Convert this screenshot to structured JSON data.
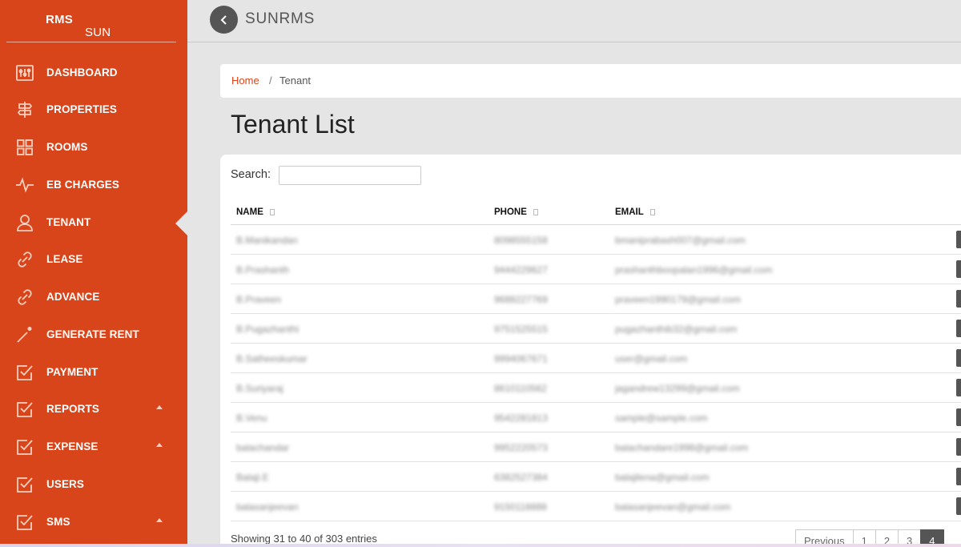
{
  "sidebar": {
    "brand_light": "SUN",
    "brand_bold": "RMS",
    "items": [
      {
        "label": "DASHBOARD",
        "icon": "dashboard-icon"
      },
      {
        "label": "PROPERTIES",
        "icon": "signpost-icon"
      },
      {
        "label": "ROOMS",
        "icon": "grid-icon"
      },
      {
        "label": "EB CHARGES",
        "icon": "pulse-icon"
      },
      {
        "label": "TENANT",
        "icon": "user-icon"
      },
      {
        "label": "LEASE",
        "icon": "link-icon"
      },
      {
        "label": "ADVANCE",
        "icon": "link-icon"
      },
      {
        "label": "GENERATE RENT",
        "icon": "magic-wand-icon"
      },
      {
        "label": "PAYMENT",
        "icon": "checkbox-icon"
      },
      {
        "label": "REPORTS",
        "icon": "checkbox-icon"
      },
      {
        "label": "EXPENSE",
        "icon": "checkbox-icon"
      },
      {
        "label": "USERS",
        "icon": "checkbox-icon"
      },
      {
        "label": "SMS",
        "icon": "checkbox-icon"
      }
    ],
    "active_item": "TENANT"
  },
  "topbar": {
    "title": "SUNRMS"
  },
  "breadcrumb": {
    "home": "Home",
    "separator": "/",
    "current": "Tenant"
  },
  "page": {
    "title": "Tenant List"
  },
  "search": {
    "label": "Search:",
    "value": ""
  },
  "table": {
    "columns": [
      "NAME",
      "PHONE",
      "EMAIL"
    ],
    "rows": [
      {
        "name": "B.Manikandan",
        "phone": "8098555158",
        "email": "bmaniprabash007@gmail.com"
      },
      {
        "name": "B.Prashanth",
        "phone": "9444229627",
        "email": "prashanthboopalan1996@gmail.com"
      },
      {
        "name": "B.Praveen",
        "phone": "9688227769",
        "email": "praveen1990179@gmail.com"
      },
      {
        "name": "B.Pugazhanthi",
        "phone": "9751525515",
        "email": "pugazhanthib32@gmail.com"
      },
      {
        "name": "B.Satheeskumar",
        "phone": "9994067671",
        "email": "user@gmail.com"
      },
      {
        "name": "B.Suriyaraj",
        "phone": "8610110562",
        "email": "jagandrew13299@gmail.com"
      },
      {
        "name": "B.Venu",
        "phone": "9542281813",
        "email": "sample@sample.com"
      },
      {
        "name": "balachandar",
        "phone": "9952220573",
        "email": "balachandare1998@gmail.com"
      },
      {
        "name": "Balaji.E",
        "phone": "6382527384",
        "email": "balajilena@gmail.com"
      },
      {
        "name": "balasanjeevan",
        "phone": "9150118888",
        "email": "balasanjeevan@gmail.com"
      }
    ]
  },
  "footer": {
    "showing": "Showing 31 to 40 of 303 entries",
    "pager": [
      "Previous",
      "1",
      "2",
      "3",
      "4"
    ],
    "active_page": "4"
  },
  "colors": {
    "sidebar": "#d9451a",
    "accent": "#d9451a",
    "dark_button": "#555555"
  }
}
